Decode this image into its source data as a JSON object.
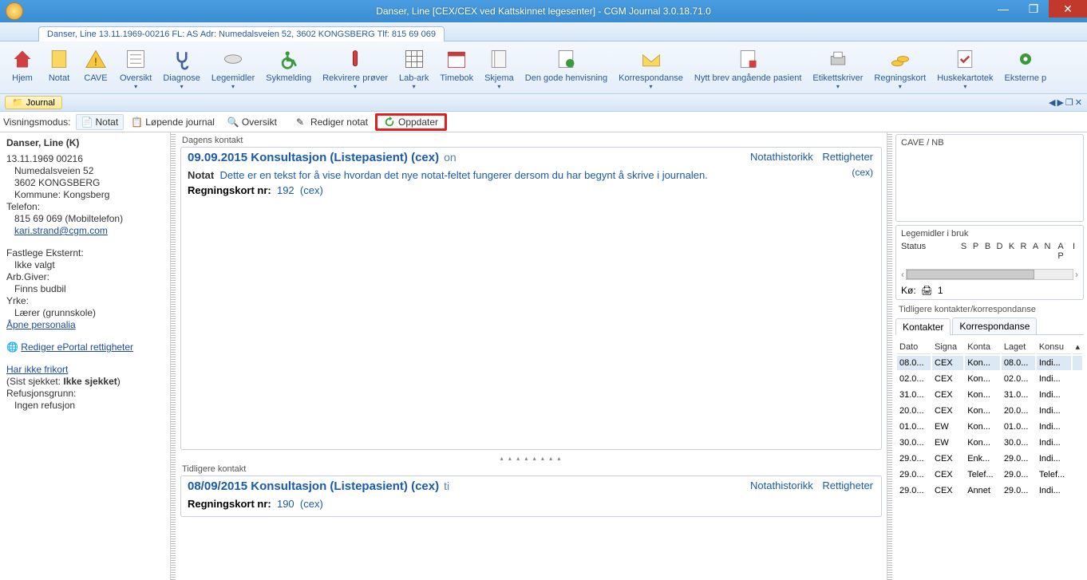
{
  "titlebar": {
    "title": "Danser, Line [CEX/CEX ved Kattskinnet legesenter] - CGM Journal 3.0.18.71.0"
  },
  "doctab": "Danser, Line 13.11.1969-00216 FL: AS Adr: Numedalsveien 52, 3602 KONGSBERG Tlf: 815 69 069",
  "ribbon": [
    {
      "label": "Hjem",
      "icon": "home"
    },
    {
      "label": "Notat",
      "icon": "note"
    },
    {
      "label": "CAVE",
      "icon": "warn"
    },
    {
      "label": "Oversikt",
      "icon": "list",
      "drop": true
    },
    {
      "label": "Diagnose",
      "icon": "diag",
      "drop": true
    },
    {
      "label": "Legemidler",
      "icon": "pill",
      "drop": true
    },
    {
      "label": "Sykmelding",
      "icon": "wheel"
    },
    {
      "label": "Rekvirere prøver",
      "icon": "tube",
      "drop": true
    },
    {
      "label": "Lab-ark",
      "icon": "grid",
      "drop": true
    },
    {
      "label": "Timebok",
      "icon": "cal"
    },
    {
      "label": "Skjema",
      "icon": "form",
      "drop": true
    },
    {
      "label": "Den gode henvisning",
      "icon": "refdoc"
    },
    {
      "label": "Korrespondanse",
      "icon": "mail",
      "drop": true
    },
    {
      "label": "Nytt brev angående pasient",
      "icon": "newdoc"
    },
    {
      "label": "Etikettskriver",
      "icon": "print",
      "drop": true
    },
    {
      "label": "Regningskort",
      "icon": "coins",
      "drop": true
    },
    {
      "label": "Huskekartotek",
      "icon": "check",
      "drop": true
    },
    {
      "label": "Eksterne p",
      "icon": "gear"
    }
  ],
  "journal_tab": "Journal",
  "toolbar": {
    "mode_label": "Visningsmodus:",
    "notat": "Notat",
    "lopende": "Løpende journal",
    "oversikt": "Oversikt",
    "rediger": "Rediger notat",
    "oppdater": "Oppdater"
  },
  "patient": {
    "name": "Danser, Line (K)",
    "id": "13.11.1969 00216",
    "addr1": "Numedalsveien 52",
    "addr2": "3602 KONGSBERG",
    "kommune": "Kommune: Kongsberg",
    "tel_label": "Telefon:",
    "tel": "815 69 069 (Mobiltelefon)",
    "email": "kari.strand@cgm.com",
    "fastlege_label": "Fastlege Eksternt:",
    "fastlege": "Ikke valgt",
    "arbgiver_label": "Arb.Giver:",
    "arbgiver": "Finns budbil",
    "yrke_label": "Yrke:",
    "yrke": "Lærer (grunnskole)",
    "apne": "Åpne personalia",
    "eportal": "Rediger ePortal rettigheter",
    "frikort": "Har ikke frikort",
    "sist_label": "(Sist sjekket: ",
    "sist_value": "Ikke sjekket",
    "sist_close": ")",
    "refusjon_label": "Refusjonsgrunn:",
    "refusjon": "Ingen refusjon"
  },
  "contacts": {
    "today_label": "Dagens kontakt",
    "today": {
      "title": "09.09.2015 Konsultasjon (Listepasient) (cex)",
      "day": "on",
      "hist": "Notathistorikk",
      "rights": "Rettigheter",
      "user": "(cex)",
      "notat_label": "Notat",
      "notat_text": "Dette er en tekst for å vise hvordan det nye notat-feltet fungerer dersom du har begynt å skrive i journalen.",
      "regn_label": "Regningskort nr:",
      "regn_num": "192",
      "regn_user": "(cex)"
    },
    "prev_label": "Tidligere kontakt",
    "prev": {
      "title": "08/09/2015 Konsultasjon (Listepasient) (cex)",
      "day": "ti",
      "hist": "Notathistorikk",
      "rights": "Rettigheter",
      "regn_label": "Regningskort nr:",
      "regn_num": "190",
      "regn_user": "(cex)"
    }
  },
  "right": {
    "cave_title": "CAVE / NB",
    "med_title": "Legemidler i bruk",
    "status": "Status",
    "cols": [
      "S",
      "P",
      "B",
      "D",
      "K",
      "R",
      "A",
      "N",
      "A P",
      "I"
    ],
    "queue_label": "Kø:",
    "queue_val": "1",
    "history_title": "Tidligere kontakter/korrespondanse",
    "tab_kontakter": "Kontakter",
    "tab_korr": "Korrespondanse",
    "headers": [
      "Dato",
      "Signa",
      "Konta",
      "Laget",
      "Konsu"
    ],
    "rows": [
      {
        "d": "08.0...",
        "s": "CEX",
        "k": "Kon...",
        "l": "08.0...",
        "ko": "Indi..."
      },
      {
        "d": "02.0...",
        "s": "CEX",
        "k": "Kon...",
        "l": "02.0...",
        "ko": "Indi..."
      },
      {
        "d": "31.0...",
        "s": "CEX",
        "k": "Kon...",
        "l": "31.0...",
        "ko": "Indi..."
      },
      {
        "d": "20.0...",
        "s": "CEX",
        "k": "Kon...",
        "l": "20.0...",
        "ko": "Indi..."
      },
      {
        "d": "01.0...",
        "s": "EW",
        "k": "Kon...",
        "l": "01.0...",
        "ko": "Indi..."
      },
      {
        "d": "30.0...",
        "s": "EW",
        "k": "Kon...",
        "l": "30.0...",
        "ko": "Indi..."
      },
      {
        "d": "29.0...",
        "s": "CEX",
        "k": "Enk...",
        "l": "29.0...",
        "ko": "Indi..."
      },
      {
        "d": "29.0...",
        "s": "CEX",
        "k": "Telef...",
        "l": "29.0...",
        "ko": "Telef..."
      },
      {
        "d": "29.0...",
        "s": "CEX",
        "k": "Annet",
        "l": "29.0...",
        "ko": "Indi..."
      }
    ]
  }
}
